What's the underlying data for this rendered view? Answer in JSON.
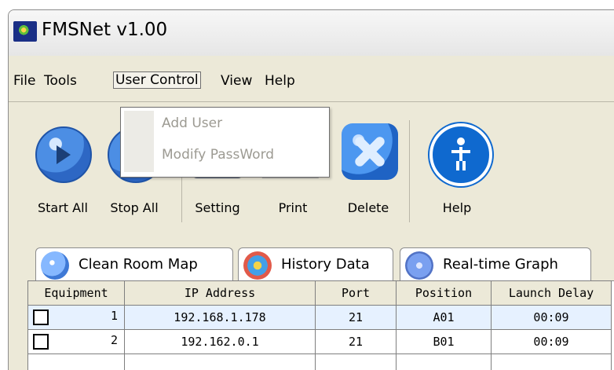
{
  "window": {
    "title": "FMSNet v1.00"
  },
  "menu": {
    "items": [
      "File",
      "Tools",
      "User Control",
      "View",
      "Help"
    ],
    "active_index": 2,
    "dropdown": [
      "Add User",
      "Modify PassWord"
    ]
  },
  "toolbar": {
    "start_all": "Start All",
    "stop_all": "Stop All",
    "setting": "Setting",
    "print": "Print",
    "delete": "Delete",
    "help": "Help"
  },
  "tabs": [
    "Clean Room Map",
    "History Data",
    "Real-time Graph"
  ],
  "table": {
    "headers": [
      "Equipment",
      "IP Address",
      "Port",
      "Position",
      "Launch Delay"
    ],
    "rows": [
      {
        "equipment": "1",
        "ip": "192.168.1.178",
        "port": "21",
        "position": "A01",
        "launch_delay": "00:09"
      },
      {
        "equipment": "2",
        "ip": "192.162.0.1",
        "port": "21",
        "position": "B01",
        "launch_delay": "00:09"
      }
    ]
  }
}
